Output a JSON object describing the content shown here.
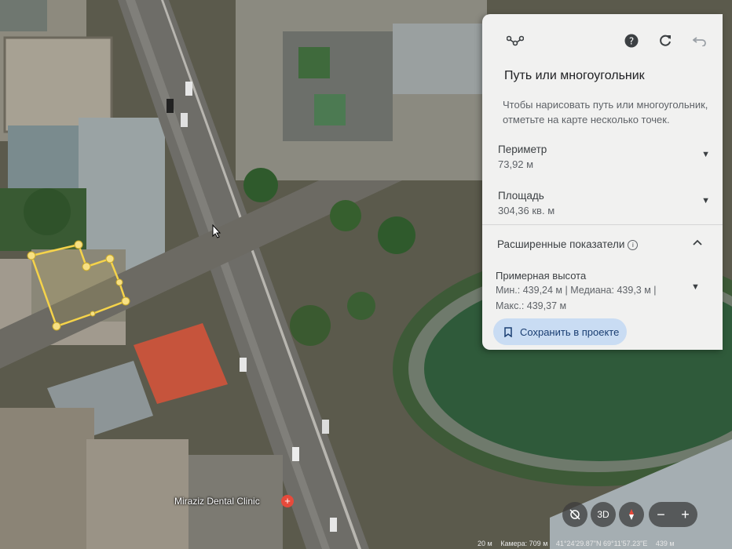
{
  "panel": {
    "title": "Путь или многоугольник",
    "hint": "Чтобы нарисовать путь или многоугольник, отметьте на карте несколько точек.",
    "toolbar_icons": [
      "path-icon",
      "help-icon",
      "refresh-icon",
      "undo-icon"
    ],
    "perimeter": {
      "label": "Периметр",
      "value": "73,92 м"
    },
    "area": {
      "label": "Площадь",
      "value": "304,36 кв. м"
    },
    "advanced": {
      "title": "Расширенные показатели",
      "elevation_label": "Примерная высота",
      "elevation_line1": "Мин.: 439,24 м | Медиана: 439,3 м |",
      "elevation_line2": "Макс.: 439,37 м"
    },
    "save_button": "Сохранить в проекте"
  },
  "map": {
    "poi_label": "Miraziz Dental Clinic",
    "polygon_color": "#f5d34a",
    "controls": {
      "view_3d": "3D",
      "zoom_out": "−",
      "zoom_in": "+"
    }
  },
  "status_bar": {
    "scale": "20 м",
    "camera": "Камера: 709 м",
    "coords": "41°24'29.87\"N 69°11'57.23\"E",
    "elevation": "439 м"
  }
}
